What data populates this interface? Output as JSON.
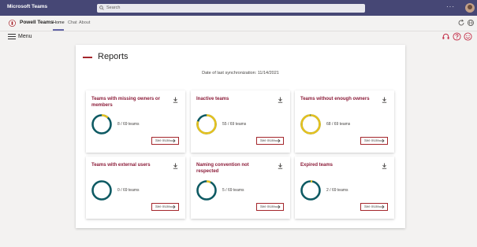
{
  "topbar": {
    "app_title": "Microsoft Teams",
    "search_placeholder": "Search",
    "more_label": "···"
  },
  "appbar": {
    "app_name": "Powell Teams",
    "tabs": [
      {
        "label": "Home"
      },
      {
        "label": "Chat"
      },
      {
        "label": "About"
      }
    ]
  },
  "menubar": {
    "menu_label": "Menu"
  },
  "reports": {
    "title": "Reports",
    "sync_text": "Date of last synchronization: 11/14/2021",
    "see_more_label": "See more",
    "cards": [
      {
        "title": "Teams with missing owners or members",
        "count_text": "8 / 69 teams",
        "fraction": 0.116
      },
      {
        "title": "Inactive teams",
        "count_text": "55 / 69 teams",
        "fraction": 0.797
      },
      {
        "title": "Teams without enough owners",
        "count_text": "68 / 69 teams",
        "fraction": 0.986
      },
      {
        "title": "Teams with external users",
        "count_text": "0 / 69 teams",
        "fraction": 0.0
      },
      {
        "title": "Naming convention not respected",
        "count_text": "5 / 69 teams",
        "fraction": 0.072
      },
      {
        "title": "Expired teams",
        "count_text": "2 / 69 teams",
        "fraction": 0.029
      }
    ]
  },
  "colors": {
    "teams_bar": "#464775",
    "accent": "#a4262c",
    "card_title": "#8c1c39",
    "ring_base": "#0e5a63",
    "ring_fill": "#e6c21f"
  }
}
